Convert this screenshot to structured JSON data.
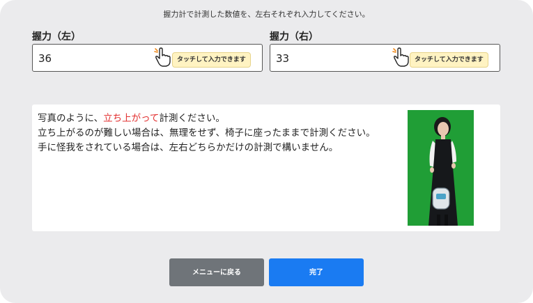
{
  "instruction": "握力計で計測した数値を、左右それぞれ入力してください。",
  "left": {
    "label": "握力（左）",
    "value": "36",
    "hint": "タッチして入力できます"
  },
  "right": {
    "label": "握力（右）",
    "value": "33",
    "hint": "タッチして入力できます"
  },
  "info": {
    "line1_pre": "写真のように、",
    "line1_highlight": "立ち上がって",
    "line1_post": "計測ください。",
    "line2": "立ち上がるのが難しい場合は、無理をせず、椅子に座ったままで計測ください。",
    "line3": "手に怪我をされている場合は、左右どちらかだけの計測で構いません。"
  },
  "buttons": {
    "menu": "メニューに戻る",
    "done": "完了"
  },
  "colors": {
    "highlight": "#e23030",
    "primary": "#1a7bf2",
    "secondary": "#6f7479",
    "hint_bg": "#fff3c2",
    "photo_bg": "#22a63a"
  },
  "icons": {
    "hand": "pointing-hand-icon"
  }
}
